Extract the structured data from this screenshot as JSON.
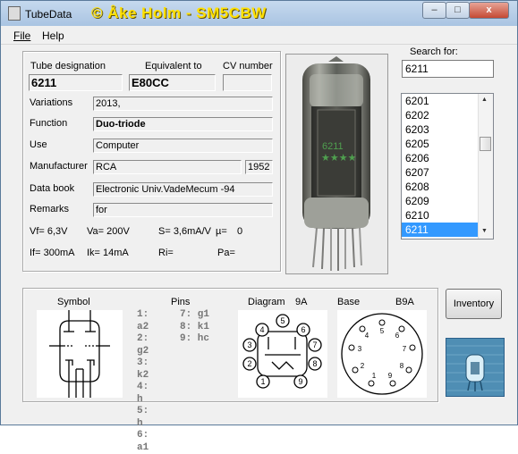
{
  "window": {
    "title": "TubeData",
    "banner": "© Åke Holm - SM5CBW",
    "controls": {
      "minimize": "–",
      "maximize": "□",
      "close": "x"
    }
  },
  "menu": [
    {
      "label": "File"
    },
    {
      "label": "Help"
    }
  ],
  "header": {
    "designation_label": "Tube designation",
    "equivalent_label": "Equivalent to",
    "cv_label": "CV number",
    "designation": "6211",
    "equivalent": "E80CC",
    "cv": ""
  },
  "details": {
    "variations_label": "Variations",
    "variations": "2013,",
    "function_label": "Function",
    "function": "Duo-triode",
    "use_label": "Use",
    "use": "Computer",
    "manufacturer_label": "Manufacturer",
    "manufacturer": "RCA",
    "year": "1952",
    "databook_label": "Data book",
    "databook": "Electronic Univ.VadeMecum -94",
    "remarks_label": "Remarks",
    "remarks": "for"
  },
  "params": {
    "vf": "Vf= 6,3V",
    "va": "Va= 200V",
    "s": "S= 3,6mA/V",
    "mu": "µ=",
    "mu_val": "0",
    "if": "If= 300mA",
    "ik": "Ik= 14mA",
    "ri": "Ri=",
    "pa": "Pa="
  },
  "tube_text": "6211",
  "search": {
    "label": "Search for:",
    "value": "6211",
    "results": [
      "6201",
      "6202",
      "6203",
      "6205",
      "6206",
      "6207",
      "6208",
      "6209",
      "6210",
      "6211"
    ],
    "selected_index": 9
  },
  "bottom": {
    "symbol_label": "Symbol",
    "pins_label": "Pins",
    "diagram_label": "Diagram",
    "diagram_code": "9A",
    "base_label": "Base",
    "base_code": "B9A",
    "pins": {
      "col1": [
        "1: a2",
        "2: g2",
        "3: k2",
        "4: h",
        "5: h",
        "6: a1"
      ],
      "col2": [
        "7: g1",
        "8: k1",
        "9: hc"
      ]
    },
    "diagram_pin_numbers": [
      "1",
      "2",
      "3",
      "4",
      "5",
      "6",
      "7",
      "8",
      "9"
    ],
    "base_pin_numbers": [
      "1",
      "2",
      "3",
      "4",
      "5",
      "6",
      "7",
      "8",
      "9"
    ]
  },
  "inventory_button": "Inventory",
  "colors": {
    "banner": "#ffe000",
    "selection": "#3399ff",
    "background": "#f0f0f0"
  }
}
